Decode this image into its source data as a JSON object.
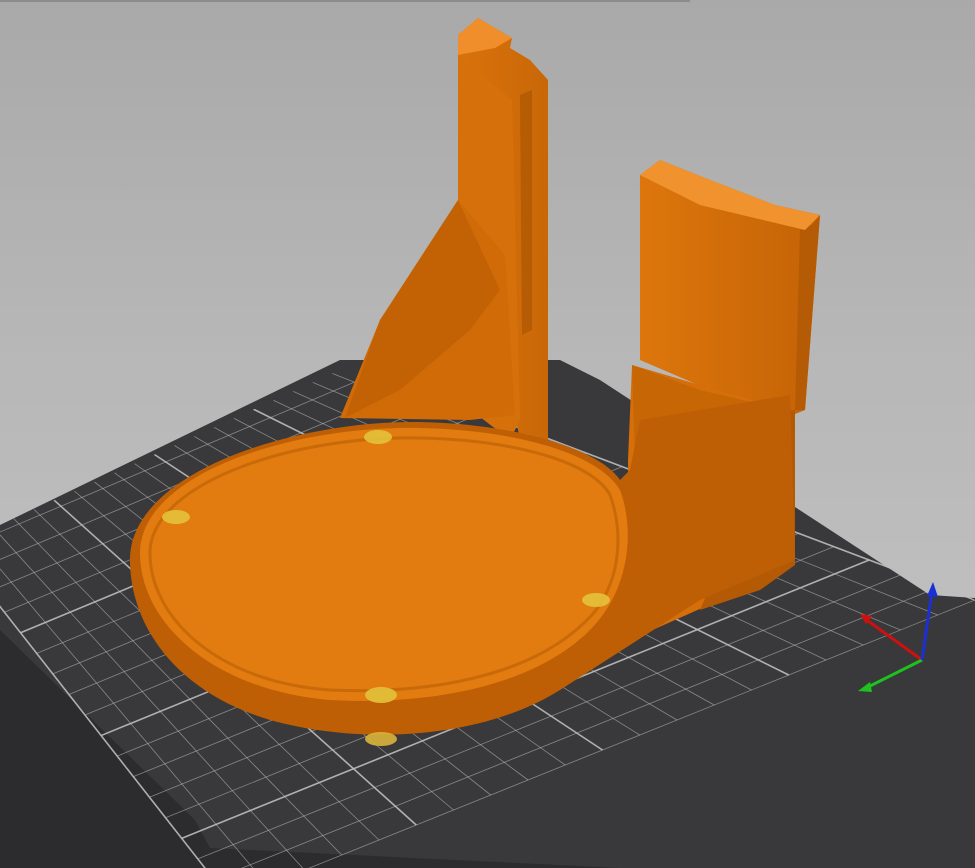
{
  "scene": {
    "type": "3d-print-slicer-viewport",
    "model_color": "#e07b12",
    "model_shadow_color": "#b85f05",
    "bed_color": "#3a3a3c",
    "grid_color": "#bdbdbd",
    "support_marker_color": "#e3c23b"
  },
  "axes": {
    "x_color": "#d01010",
    "y_color": "#1ec21e",
    "z_color": "#1a2fd6"
  }
}
